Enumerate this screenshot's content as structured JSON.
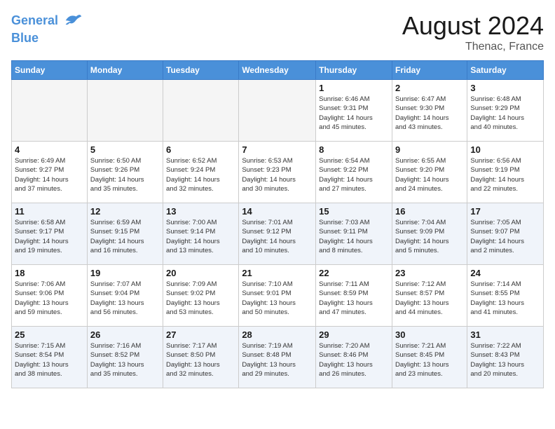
{
  "header": {
    "logo_line1": "General",
    "logo_line2": "Blue",
    "month_year": "August 2024",
    "location": "Thenac, France"
  },
  "days_of_week": [
    "Sunday",
    "Monday",
    "Tuesday",
    "Wednesday",
    "Thursday",
    "Friday",
    "Saturday"
  ],
  "weeks": [
    [
      {
        "day": "",
        "info": ""
      },
      {
        "day": "",
        "info": ""
      },
      {
        "day": "",
        "info": ""
      },
      {
        "day": "",
        "info": ""
      },
      {
        "day": "1",
        "info": "Sunrise: 6:46 AM\nSunset: 9:31 PM\nDaylight: 14 hours\nand 45 minutes."
      },
      {
        "day": "2",
        "info": "Sunrise: 6:47 AM\nSunset: 9:30 PM\nDaylight: 14 hours\nand 43 minutes."
      },
      {
        "day": "3",
        "info": "Sunrise: 6:48 AM\nSunset: 9:29 PM\nDaylight: 14 hours\nand 40 minutes."
      }
    ],
    [
      {
        "day": "4",
        "info": "Sunrise: 6:49 AM\nSunset: 9:27 PM\nDaylight: 14 hours\nand 37 minutes."
      },
      {
        "day": "5",
        "info": "Sunrise: 6:50 AM\nSunset: 9:26 PM\nDaylight: 14 hours\nand 35 minutes."
      },
      {
        "day": "6",
        "info": "Sunrise: 6:52 AM\nSunset: 9:24 PM\nDaylight: 14 hours\nand 32 minutes."
      },
      {
        "day": "7",
        "info": "Sunrise: 6:53 AM\nSunset: 9:23 PM\nDaylight: 14 hours\nand 30 minutes."
      },
      {
        "day": "8",
        "info": "Sunrise: 6:54 AM\nSunset: 9:22 PM\nDaylight: 14 hours\nand 27 minutes."
      },
      {
        "day": "9",
        "info": "Sunrise: 6:55 AM\nSunset: 9:20 PM\nDaylight: 14 hours\nand 24 minutes."
      },
      {
        "day": "10",
        "info": "Sunrise: 6:56 AM\nSunset: 9:19 PM\nDaylight: 14 hours\nand 22 minutes."
      }
    ],
    [
      {
        "day": "11",
        "info": "Sunrise: 6:58 AM\nSunset: 9:17 PM\nDaylight: 14 hours\nand 19 minutes."
      },
      {
        "day": "12",
        "info": "Sunrise: 6:59 AM\nSunset: 9:15 PM\nDaylight: 14 hours\nand 16 minutes."
      },
      {
        "day": "13",
        "info": "Sunrise: 7:00 AM\nSunset: 9:14 PM\nDaylight: 14 hours\nand 13 minutes."
      },
      {
        "day": "14",
        "info": "Sunrise: 7:01 AM\nSunset: 9:12 PM\nDaylight: 14 hours\nand 10 minutes."
      },
      {
        "day": "15",
        "info": "Sunrise: 7:03 AM\nSunset: 9:11 PM\nDaylight: 14 hours\nand 8 minutes."
      },
      {
        "day": "16",
        "info": "Sunrise: 7:04 AM\nSunset: 9:09 PM\nDaylight: 14 hours\nand 5 minutes."
      },
      {
        "day": "17",
        "info": "Sunrise: 7:05 AM\nSunset: 9:07 PM\nDaylight: 14 hours\nand 2 minutes."
      }
    ],
    [
      {
        "day": "18",
        "info": "Sunrise: 7:06 AM\nSunset: 9:06 PM\nDaylight: 13 hours\nand 59 minutes."
      },
      {
        "day": "19",
        "info": "Sunrise: 7:07 AM\nSunset: 9:04 PM\nDaylight: 13 hours\nand 56 minutes."
      },
      {
        "day": "20",
        "info": "Sunrise: 7:09 AM\nSunset: 9:02 PM\nDaylight: 13 hours\nand 53 minutes."
      },
      {
        "day": "21",
        "info": "Sunrise: 7:10 AM\nSunset: 9:01 PM\nDaylight: 13 hours\nand 50 minutes."
      },
      {
        "day": "22",
        "info": "Sunrise: 7:11 AM\nSunset: 8:59 PM\nDaylight: 13 hours\nand 47 minutes."
      },
      {
        "day": "23",
        "info": "Sunrise: 7:12 AM\nSunset: 8:57 PM\nDaylight: 13 hours\nand 44 minutes."
      },
      {
        "day": "24",
        "info": "Sunrise: 7:14 AM\nSunset: 8:55 PM\nDaylight: 13 hours\nand 41 minutes."
      }
    ],
    [
      {
        "day": "25",
        "info": "Sunrise: 7:15 AM\nSunset: 8:54 PM\nDaylight: 13 hours\nand 38 minutes."
      },
      {
        "day": "26",
        "info": "Sunrise: 7:16 AM\nSunset: 8:52 PM\nDaylight: 13 hours\nand 35 minutes."
      },
      {
        "day": "27",
        "info": "Sunrise: 7:17 AM\nSunset: 8:50 PM\nDaylight: 13 hours\nand 32 minutes."
      },
      {
        "day": "28",
        "info": "Sunrise: 7:19 AM\nSunset: 8:48 PM\nDaylight: 13 hours\nand 29 minutes."
      },
      {
        "day": "29",
        "info": "Sunrise: 7:20 AM\nSunset: 8:46 PM\nDaylight: 13 hours\nand 26 minutes."
      },
      {
        "day": "30",
        "info": "Sunrise: 7:21 AM\nSunset: 8:45 PM\nDaylight: 13 hours\nand 23 minutes."
      },
      {
        "day": "31",
        "info": "Sunrise: 7:22 AM\nSunset: 8:43 PM\nDaylight: 13 hours\nand 20 minutes."
      }
    ]
  ]
}
